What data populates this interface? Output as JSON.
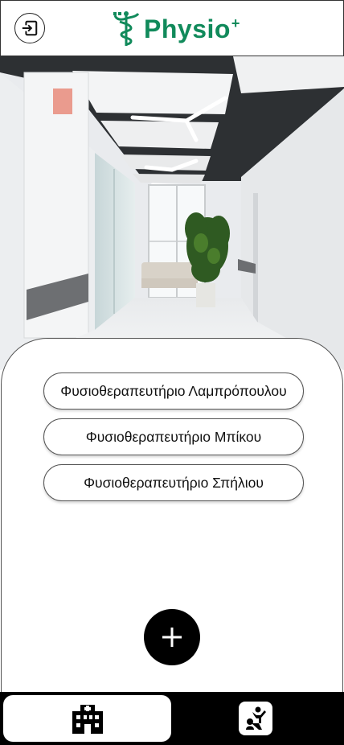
{
  "header": {
    "logo_text": "Physio",
    "logo_sup": "+",
    "logout_icon": "logout-icon"
  },
  "hero": {
    "icon": "hallway-photo"
  },
  "clinics": [
    {
      "label": "Φυσιοθεραπευτήριο Λαμπρόπουλου"
    },
    {
      "label": "Φυσιοθεραπευτήριο Μπίκου"
    },
    {
      "label": "Φυσιοθεραπευτήριο Σπήλιου"
    }
  ],
  "add_button": {
    "icon": "plus-icon"
  },
  "bottom_nav": {
    "items": [
      {
        "icon": "hospital-icon",
        "active": true
      },
      {
        "icon": "physiotherapy-icon",
        "active": false
      }
    ]
  },
  "colors": {
    "brand": "#118a5b",
    "nav_bg": "#000000"
  }
}
